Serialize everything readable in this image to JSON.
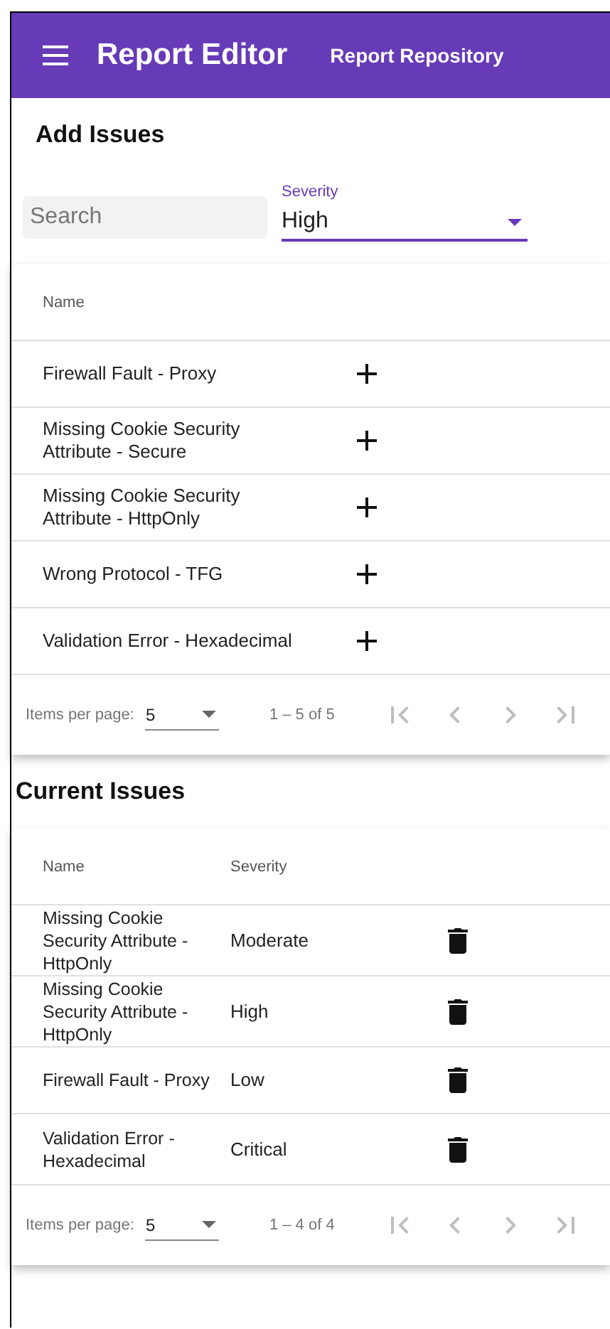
{
  "toolbar": {
    "title": "Report Editor",
    "link": "Report Repository"
  },
  "add_issues": {
    "heading": "Add Issues",
    "search": {
      "placeholder": "Search"
    },
    "severity": {
      "label": "Severity",
      "value": "High"
    },
    "table": {
      "columns": [
        "Name"
      ],
      "rows": [
        {
          "name": "Firewall Fault - Proxy"
        },
        {
          "name": "Missing Cookie Security Attribute - Secure"
        },
        {
          "name": "Missing Cookie Security Attribute - HttpOnly"
        },
        {
          "name": "Wrong Protocol - TFG"
        },
        {
          "name": "Validation Error - Hexadecimal"
        }
      ]
    },
    "paginator": {
      "label": "Items per page:",
      "page_size": "5",
      "range": "1 – 5 of 5",
      "buttons": [
        {
          "kind": "first",
          "disabled": true
        },
        {
          "kind": "prev",
          "disabled": true
        },
        {
          "kind": "next",
          "disabled": true
        },
        {
          "kind": "last",
          "disabled": true
        }
      ]
    }
  },
  "current_issues": {
    "heading": "Current Issues",
    "table": {
      "columns": [
        "Name",
        "Severity"
      ],
      "rows": [
        {
          "name": "Missing Cookie Security Attribute - HttpOnly",
          "severity": "Moderate"
        },
        {
          "name": "Missing Cookie Security Attribute - HttpOnly",
          "severity": "High"
        },
        {
          "name": "Firewall Fault - Proxy",
          "severity": "Low"
        },
        {
          "name": "Validation Error - Hexadecimal",
          "severity": "Critical"
        }
      ]
    },
    "paginator": {
      "label": "Items per page:",
      "page_size": "5",
      "range": "1 – 4 of 4",
      "buttons": [
        {
          "kind": "first",
          "disabled": true
        },
        {
          "kind": "prev",
          "disabled": true
        },
        {
          "kind": "next",
          "disabled": true
        },
        {
          "kind": "last",
          "disabled": true
        }
      ]
    }
  }
}
